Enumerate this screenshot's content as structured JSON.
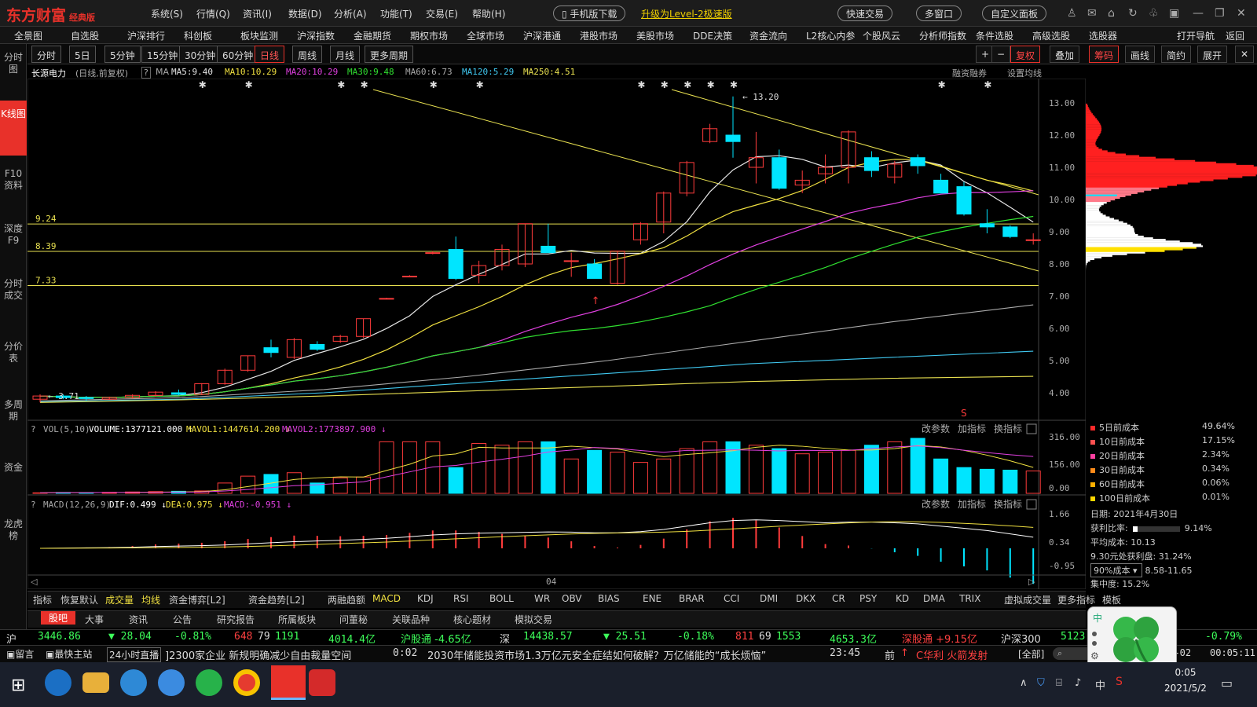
{
  "app": {
    "logo": "东方财富",
    "edition": "经典版",
    "menus": [
      "系统(S)",
      "行情(Q)",
      "资讯(I)",
      "数据(D)",
      "分析(A)",
      "功能(T)",
      "交易(E)",
      "帮助(H)"
    ],
    "mobile_btn": "手机版下载",
    "upgrade": "升级为Level-2极速版",
    "quick_trade": "快速交易",
    "multi_window": "多窗口",
    "custom_panel": "自定义面板"
  },
  "nav2": {
    "items": [
      "全景图",
      "自选股",
      "沪深排行",
      "科创板",
      "板块监测",
      "沪深指数",
      "金融期货",
      "期权市场",
      "全球市场",
      "沪深港通",
      "港股市场",
      "美股市场",
      "DDE决策",
      "资金流向",
      "L2核心内参",
      "个股风云",
      "分析师指数",
      "条件选股",
      "高级选股",
      "选股器"
    ],
    "right": [
      "打开导航",
      "返回"
    ]
  },
  "left_tabs": [
    "分时图",
    "K线图",
    "F10资料",
    "深度F9",
    "分时成交",
    "分价表",
    "多周期",
    "资金",
    "龙虎榜"
  ],
  "periods": {
    "items": [
      "分时",
      "5日",
      "5分钟",
      "15分钟",
      "30分钟",
      "60分钟",
      "日线",
      "周线",
      "月线",
      "更多周期"
    ],
    "active": "日线"
  },
  "toolbar_right": {
    "items": [
      "复权",
      "叠加",
      "筹码",
      "画线",
      "简约",
      "展开"
    ]
  },
  "stock": {
    "name": "长源电力",
    "period_note": "(日线,前复权)",
    "ma_label": "MA",
    "ma5": "MA5:9.40",
    "ma10": "MA10:10.29",
    "ma20": "MA20:10.29",
    "ma30": "MA30:9.48",
    "ma60": "MA60:6.73",
    "ma120": "MA120:5.29",
    "ma250": "MA250:4.51",
    "margin": "融资融券",
    "settings": "设置均线"
  },
  "colors": {
    "up": "#ff3b3b",
    "down": "#00e5ff",
    "ma5": "#e6e6e6",
    "ma10": "#f0e040",
    "ma20": "#e040e0",
    "ma30": "#30e030",
    "ma60": "#aaaaaa",
    "ma120": "#40c8f0",
    "ma250": "#e8e050",
    "hline": "#e8e050",
    "red": "#e8312a"
  },
  "chart_data": {
    "type": "candlestick",
    "price_axis": [
      4.0,
      5.0,
      6.0,
      7.0,
      8.0,
      9.0,
      10.0,
      11.0,
      12.0,
      13.0
    ],
    "hlines": [
      {
        "label": "9.24",
        "value": 9.24
      },
      {
        "label": "8.39",
        "value": 8.39
      },
      {
        "label": "7.33",
        "value": 7.33
      }
    ],
    "high_label": "13.20",
    "low_label": "3.71",
    "candles": [
      {
        "o": 3.8,
        "h": 3.95,
        "l": 3.7,
        "c": 3.9
      },
      {
        "o": 3.9,
        "h": 3.95,
        "l": 3.8,
        "c": 3.85
      },
      {
        "o": 3.85,
        "h": 3.9,
        "l": 3.75,
        "c": 3.82
      },
      {
        "o": 3.8,
        "h": 3.88,
        "l": 3.78,
        "c": 3.85
      },
      {
        "o": 3.85,
        "h": 3.95,
        "l": 3.82,
        "c": 3.92
      },
      {
        "o": 3.92,
        "h": 4.05,
        "l": 3.88,
        "c": 4.02
      },
      {
        "o": 4.0,
        "h": 4.1,
        "l": 3.92,
        "c": 3.95
      },
      {
        "o": 3.95,
        "h": 4.3,
        "l": 3.93,
        "c": 4.28
      },
      {
        "o": 4.28,
        "h": 4.75,
        "l": 4.25,
        "c": 4.7
      },
      {
        "o": 4.7,
        "h": 5.15,
        "l": 4.65,
        "c": 5.15
      },
      {
        "o": 5.4,
        "h": 5.65,
        "l": 5.1,
        "c": 5.25
      },
      {
        "o": 5.1,
        "h": 5.7,
        "l": 5.05,
        "c": 5.65
      },
      {
        "o": 5.5,
        "h": 5.6,
        "l": 5.3,
        "c": 5.35
      },
      {
        "o": 5.6,
        "h": 5.8,
        "l": 5.55,
        "c": 5.75
      },
      {
        "o": 5.75,
        "h": 6.3,
        "l": 5.7,
        "c": 6.3
      },
      {
        "o": 6.93,
        "h": 6.95,
        "l": 6.9,
        "c": 6.93
      },
      {
        "o": 7.62,
        "h": 7.65,
        "l": 7.6,
        "c": 7.62
      },
      {
        "o": 8.35,
        "h": 8.4,
        "l": 8.3,
        "c": 8.35
      },
      {
        "o": 8.45,
        "h": 8.85,
        "l": 7.5,
        "c": 7.55
      },
      {
        "o": 7.65,
        "h": 8.1,
        "l": 7.4,
        "c": 7.95
      },
      {
        "o": 7.95,
        "h": 8.6,
        "l": 7.8,
        "c": 8.45
      },
      {
        "o": 8.0,
        "h": 9.25,
        "l": 7.9,
        "c": 9.25
      },
      {
        "o": 8.55,
        "h": 9.25,
        "l": 8.35,
        "c": 8.35
      },
      {
        "o": 8.1,
        "h": 8.35,
        "l": 7.6,
        "c": 8.1
      },
      {
        "o": 8.0,
        "h": 8.15,
        "l": 7.6,
        "c": 7.55
      },
      {
        "o": 7.4,
        "h": 8.4,
        "l": 7.35,
        "c": 8.4
      },
      {
        "o": 8.75,
        "h": 9.3,
        "l": 8.6,
        "c": 9.25
      },
      {
        "o": 9.3,
        "h": 10.25,
        "l": 8.95,
        "c": 10.2
      },
      {
        "o": 10.2,
        "h": 11.2,
        "l": 10.1,
        "c": 11.15
      },
      {
        "o": 11.8,
        "h": 12.35,
        "l": 11.75,
        "c": 12.2
      },
      {
        "o": 12.0,
        "h": 13.2,
        "l": 11.3,
        "c": 11.8
      },
      {
        "o": 11.0,
        "h": 12.1,
        "l": 10.5,
        "c": 11.3
      },
      {
        "o": 11.3,
        "h": 11.55,
        "l": 10.3,
        "c": 10.35
      },
      {
        "o": 10.45,
        "h": 10.9,
        "l": 10.2,
        "c": 10.6
      },
      {
        "o": 10.8,
        "h": 11.4,
        "l": 10.5,
        "c": 11.0
      },
      {
        "o": 11.0,
        "h": 12.15,
        "l": 10.5,
        "c": 12.1
      },
      {
        "o": 11.3,
        "h": 11.5,
        "l": 10.7,
        "c": 10.9
      },
      {
        "o": 10.7,
        "h": 11.2,
        "l": 10.5,
        "c": 11.1
      },
      {
        "o": 11.3,
        "h": 11.4,
        "l": 10.8,
        "c": 11.05
      },
      {
        "o": 10.6,
        "h": 10.8,
        "l": 10.2,
        "c": 10.2
      },
      {
        "o": 10.4,
        "h": 10.55,
        "l": 9.5,
        "c": 9.55
      },
      {
        "o": 9.25,
        "h": 9.7,
        "l": 8.95,
        "c": 9.15
      },
      {
        "o": 9.15,
        "h": 9.2,
        "l": 8.8,
        "c": 8.85
      },
      {
        "o": 8.75,
        "h": 8.95,
        "l": 8.6,
        "c": 8.75
      }
    ],
    "volume": {
      "label": "VOL(5,10)",
      "volume": "VOLUME:1377121.000",
      "mavol1": "MAVOL1:1447614.200",
      "mavol2": "MAVOL2:1773897.900",
      "axis": [
        "316.00",
        "156.00",
        "0.00"
      ],
      "values": [
        3,
        5,
        4,
        6,
        8,
        10,
        12,
        14,
        60,
        100,
        110,
        120,
        60,
        90,
        95,
        300,
        300,
        300,
        150,
        290,
        280,
        300,
        300,
        200,
        250,
        240,
        180,
        200,
        260,
        300,
        300,
        280,
        260,
        230,
        240,
        250,
        280,
        300,
        320,
        200,
        150,
        140,
        135,
        130
      ]
    },
    "macd": {
      "label": "MACD(12,26,9)",
      "dif": "DIF:0.499",
      "dea": "DEA:0.975",
      "macd": "MACD:-0.951",
      "axis": [
        "1.66",
        "0.34",
        "-0.95"
      ],
      "x_tick": "04"
    }
  },
  "panel_controls": [
    "改参数",
    "加指标",
    "换指标"
  ],
  "chip": {
    "rows": [
      {
        "label": "5日前成本",
        "value": "49.64%",
        "color": "#ff2a2a"
      },
      {
        "label": "10日前成本",
        "value": "17.15%",
        "color": "#ff5050"
      },
      {
        "label": "20日前成本",
        "value": "2.34%",
        "color": "#ff40a0"
      },
      {
        "label": "30日前成本",
        "value": "0.34%",
        "color": "#ff8c1a"
      },
      {
        "label": "60日前成本",
        "value": "0.06%",
        "color": "#ffb000"
      },
      {
        "label": "100日前成本",
        "value": "0.01%",
        "color": "#ffd700"
      }
    ],
    "date": "日期: 2021年4月30日",
    "profit_ratio": "获利比率:",
    "profit_value": "9.14%",
    "avg_cost": "平均成本: 10.13",
    "profit_930": "9.30元处获利盘: 31.24%",
    "cost90_sel": "90%成本",
    "cost90_range": "8.58-11.65",
    "concentration": "集中度: 15.2%"
  },
  "ind_tabs": [
    "指标",
    "恢复默认",
    "成交量",
    "均线",
    "资金博弈[L2]",
    "资金趋势[L2]",
    "两融趋额",
    "MACD",
    "KDJ",
    "RSI",
    "BOLL",
    "WR",
    "OBV",
    "BIAS",
    "ENE",
    "BRAR",
    "CCI",
    "DMI",
    "DKX",
    "CR",
    "PSY",
    "KD",
    "DMA",
    "TRIX",
    "虚拟成交量",
    "更多指标",
    "模板"
  ],
  "news_tabs": [
    "股吧",
    "大事",
    "资讯",
    "公告",
    "研究报告",
    "所属板块",
    "问董秘",
    "关联品种",
    "核心题材",
    "模拟交易"
  ],
  "ticker": {
    "sh": "沪",
    "sh_idx": "3446.86",
    "sh_chg": "▼ 28.04",
    "sh_pct": "-0.81%",
    "sh_up": "648",
    "sh_flat": "79",
    "sh_dn": "1191",
    "sh_amt": "4014.4亿",
    "sgt": "沪股通 -4.65亿",
    "sz": "深",
    "sz_idx": "14438.57",
    "sz_chg": "▼ 25.51",
    "sz_pct": "-0.18%",
    "sz_up": "811",
    "sz_flat": "69",
    "sz_dn": "1553",
    "sz_amt": "4653.3亿",
    "szgt": "深股通 +9.15亿",
    "hs300": "沪深300",
    "hs300_val": "5123.49",
    "hs300_pct": "-0.79%"
  },
  "news": {
    "msg": "留言",
    "home": "最快主站",
    "live": "24小时直播",
    "n1": "]2300家企业 新规明确减少自由裁量空间",
    "t1": "0:02",
    "n2": "2030年储能投资市场1.3万亿元安全症结如何破解？万亿储能的“成长烦恼”",
    "t2": "23:45",
    "pre": "前",
    "tip": "C华利 火箭发射",
    "all": "[全部]",
    "date_short": "05-02",
    "time": "00:05:11"
  },
  "taskbar": {
    "time": "0:05",
    "date": "2021/5/2",
    "ime": "中"
  }
}
